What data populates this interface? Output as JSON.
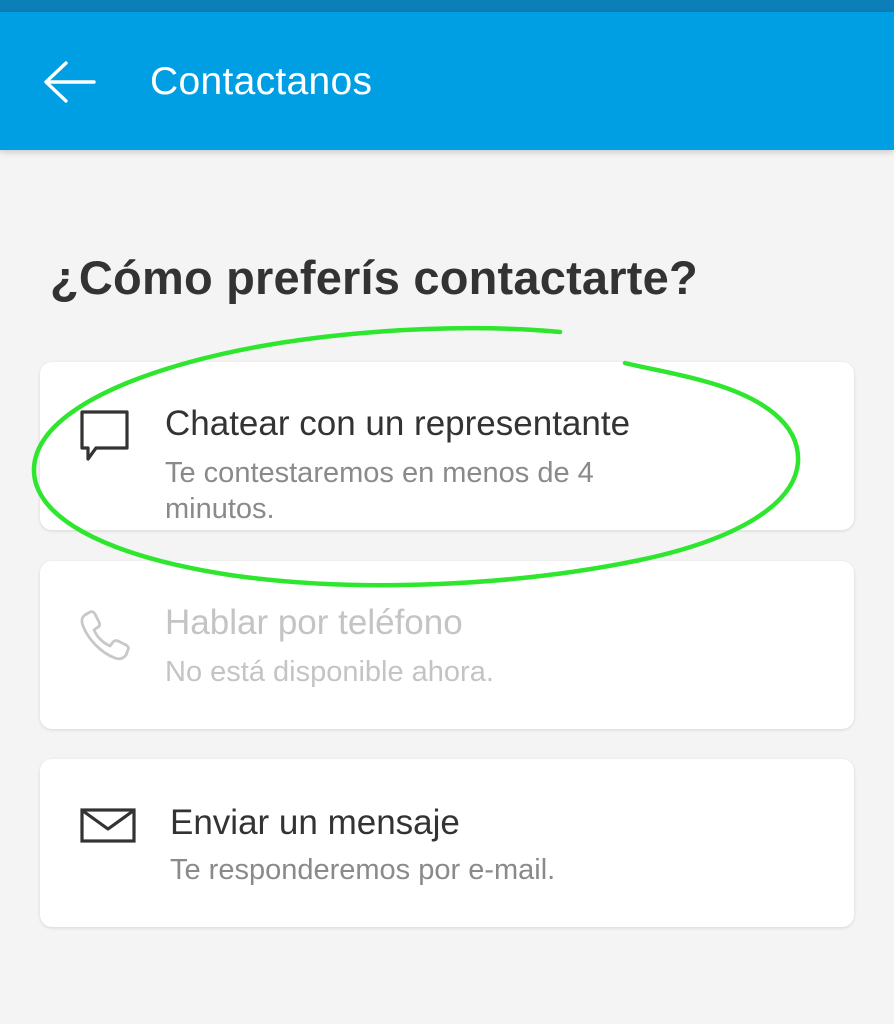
{
  "app_bar": {
    "title": "Contactanos",
    "back_icon": "arrow-left-icon",
    "background_color": "#009ee3"
  },
  "heading": "¿Cómo preferís contactarte?",
  "options": [
    {
      "icon": "chat-bubble-icon",
      "title": "Chatear con un representante",
      "subtitle": "Te contestaremos en menos de 4 minutos.",
      "enabled": true
    },
    {
      "icon": "phone-icon",
      "title": "Hablar por teléfono",
      "subtitle": "No está disponible ahora.",
      "enabled": false
    },
    {
      "icon": "envelope-icon",
      "title": "Enviar un mensaje",
      "subtitle": "Te responderemos por e-mail.",
      "enabled": true
    }
  ],
  "annotation": {
    "shape": "hand-drawn ellipse",
    "color": "#2ee62e",
    "target": "options.0"
  }
}
